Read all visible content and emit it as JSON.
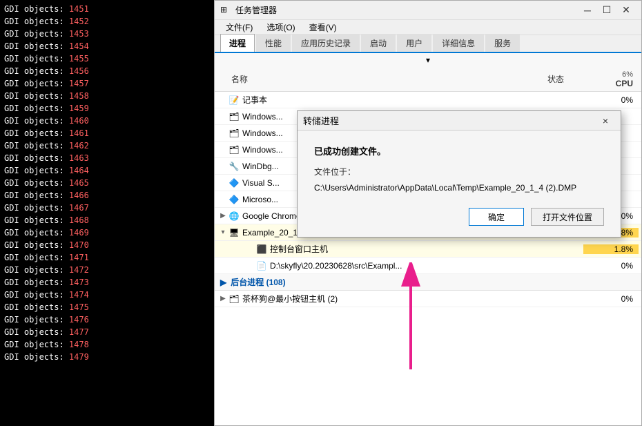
{
  "terminal": {
    "lines": [
      {
        "label": "GDI objects:",
        "num": "1451"
      },
      {
        "label": "GDI objects:",
        "num": "1452"
      },
      {
        "label": "GDI objects:",
        "num": "1453"
      },
      {
        "label": "GDI objects:",
        "num": "1454"
      },
      {
        "label": "GDI objects:",
        "num": "1455"
      },
      {
        "label": "GDI objects:",
        "num": "1456"
      },
      {
        "label": "GDI objects:",
        "num": "1457"
      },
      {
        "label": "GDI objects:",
        "num": "1458"
      },
      {
        "label": "GDI objects:",
        "num": "1459"
      },
      {
        "label": "GDI objects:",
        "num": "1460"
      },
      {
        "label": "GDI objects:",
        "num": "1461"
      },
      {
        "label": "GDI objects:",
        "num": "1462"
      },
      {
        "label": "GDI objects:",
        "num": "1463"
      },
      {
        "label": "GDI objects:",
        "num": "1464"
      },
      {
        "label": "GDI objects:",
        "num": "1465"
      },
      {
        "label": "GDI objects:",
        "num": "1466"
      },
      {
        "label": "GDI objects:",
        "num": "1467"
      },
      {
        "label": "GDI objects:",
        "num": "1468"
      },
      {
        "label": "GDI objects:",
        "num": "1469"
      },
      {
        "label": "GDI objects:",
        "num": "1470"
      },
      {
        "label": "GDI objects:",
        "num": "1471"
      },
      {
        "label": "GDI objects:",
        "num": "1472"
      },
      {
        "label": "GDI objects:",
        "num": "1473"
      },
      {
        "label": "GDI objects:",
        "num": "1474"
      },
      {
        "label": "GDI objects:",
        "num": "1475"
      },
      {
        "label": "GDI objects:",
        "num": "1476"
      },
      {
        "label": "GDI objects:",
        "num": "1477"
      },
      {
        "label": "GDI objects:",
        "num": "1478"
      },
      {
        "label": "GDI objects:",
        "num": "1479"
      }
    ]
  },
  "taskman": {
    "title": "任务管理器",
    "titlebar_icon": "⊞",
    "menubar": [
      {
        "label": "文件(F)"
      },
      {
        "label": "选项(O)"
      },
      {
        "label": "查看(V)"
      }
    ],
    "tabs": [
      {
        "label": "进程",
        "active": true
      },
      {
        "label": "性能"
      },
      {
        "label": "应用历史记录"
      },
      {
        "label": "启动"
      },
      {
        "label": "用户"
      },
      {
        "label": "详细信息"
      },
      {
        "label": "服务"
      }
    ],
    "col_name": "名称",
    "col_status": "状态",
    "col_cpu": "CPU",
    "cpu_percent": "6%",
    "processes": [
      {
        "name": "记事本",
        "icon": "📝",
        "status": "",
        "cpu": "0%",
        "expanded": false,
        "indent": 0
      },
      {
        "name": "Windows...",
        "icon": "🗂",
        "status": "",
        "cpu": "",
        "expanded": false,
        "indent": 0
      },
      {
        "name": "Windows...",
        "icon": "🗂",
        "status": "",
        "cpu": "",
        "expanded": false,
        "indent": 0
      },
      {
        "name": "Windows...",
        "icon": "🗂",
        "status": "",
        "cpu": "",
        "expanded": false,
        "indent": 0
      },
      {
        "name": "WinDbg...",
        "icon": "🔧",
        "status": "",
        "cpu": "",
        "expanded": false,
        "indent": 0
      },
      {
        "name": "Visual S...",
        "icon": "🔷",
        "status": "",
        "cpu": "",
        "expanded": false,
        "indent": 0
      },
      {
        "name": "Microso...",
        "icon": "🔷",
        "status": "",
        "cpu": "",
        "expanded": false,
        "indent": 0
      },
      {
        "name": "Google Chrome (32 位) (9)",
        "icon": "🌐",
        "status": "",
        "cpu": "0%",
        "expanded": false,
        "indent": 0
      },
      {
        "name": "Example_20_1_4 (32 位) (2)",
        "icon": "🖥",
        "status": "",
        "cpu": "1.8%",
        "expanded": true,
        "indent": 0,
        "highlighted": true
      },
      {
        "name": "控制台窗口主机",
        "icon": "⬛",
        "status": "",
        "cpu": "1.8%",
        "expanded": false,
        "indent": 1,
        "highlighted": true
      },
      {
        "name": "D:\\skyfly\\20.20230628\\src\\Exampl...",
        "icon": "📄",
        "status": "",
        "cpu": "0%",
        "expanded": false,
        "indent": 1
      }
    ],
    "bg_section": "后台进程 (108)",
    "bg_process": "茶杯狗@最小按钮主机 (2)"
  },
  "dump_dialog": {
    "title": "转储进程",
    "close_label": "×",
    "success_text": "已成功创建文件。",
    "location_label": "文件位于：",
    "path": "C:\\Users\\Administrator\\AppData\\Local\\Temp\\Example_20_1_4 (2).DMP",
    "btn_ok": "确定",
    "btn_open": "打开文件位置"
  }
}
